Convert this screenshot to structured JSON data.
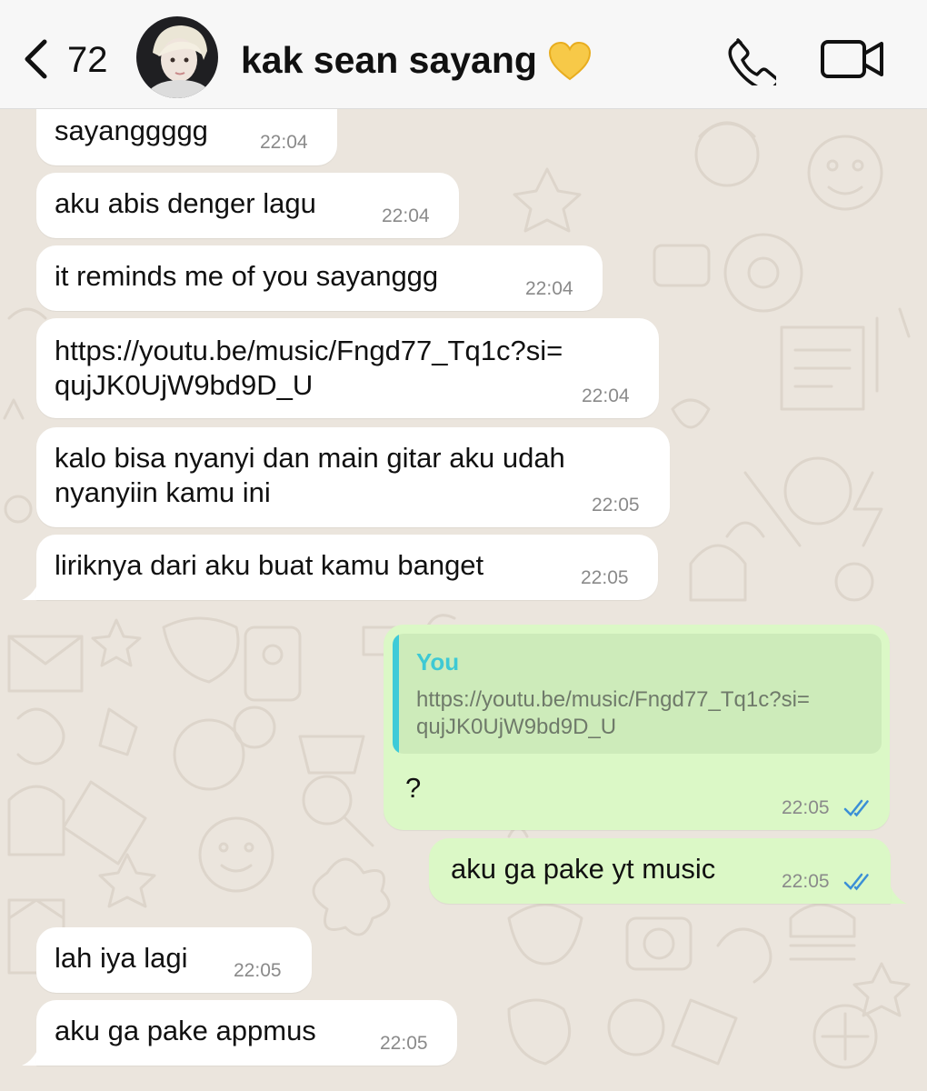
{
  "header": {
    "back_count": "72",
    "contact_name": "kak sean sayang",
    "icons": {
      "back": "chevron-left-icon",
      "heart": "yellow-heart-icon",
      "call": "phone-icon",
      "video": "video-camera-icon"
    }
  },
  "colors": {
    "incoming_bubble": "#ffffff",
    "outgoing_bubble": "#dbf8c6",
    "quote_accent": "#3ecbd8",
    "read_ticks": "#3b8fd6",
    "wallpaper": "#ebe5dd"
  },
  "messages": [
    {
      "direction": "in",
      "lines": [
        "sayanggggg"
      ],
      "time": "22:04"
    },
    {
      "direction": "in",
      "lines": [
        "aku abis denger lagu"
      ],
      "time": "22:04"
    },
    {
      "direction": "in",
      "lines": [
        "it reminds me of you sayanggg"
      ],
      "time": "22:04"
    },
    {
      "direction": "in",
      "lines": [
        "https://youtu.be/music/Fngd77_Tq1c?si=",
        "qujJK0UjW9bd9D_U"
      ],
      "time": "22:04"
    },
    {
      "direction": "in",
      "lines": [
        "kalo bisa nyanyi dan main gitar aku udah",
        "nyanyiin kamu ini"
      ],
      "time": "22:05"
    },
    {
      "direction": "in",
      "lines": [
        "liriknya dari aku buat kamu banget"
      ],
      "time": "22:05"
    },
    {
      "direction": "out",
      "quote": {
        "author": "You",
        "lines": [
          "https://youtu.be/music/Fngd77_Tq1c?si=",
          "qujJK0UjW9bd9D_U"
        ]
      },
      "lines": [
        "?"
      ],
      "time": "22:05",
      "status": "read"
    },
    {
      "direction": "out",
      "lines": [
        "aku ga pake yt music"
      ],
      "time": "22:05",
      "status": "read"
    },
    {
      "direction": "in",
      "lines": [
        "lah iya lagi"
      ],
      "time": "22:05"
    },
    {
      "direction": "in",
      "lines": [
        "aku ga pake appmus"
      ],
      "time": "22:05"
    }
  ]
}
